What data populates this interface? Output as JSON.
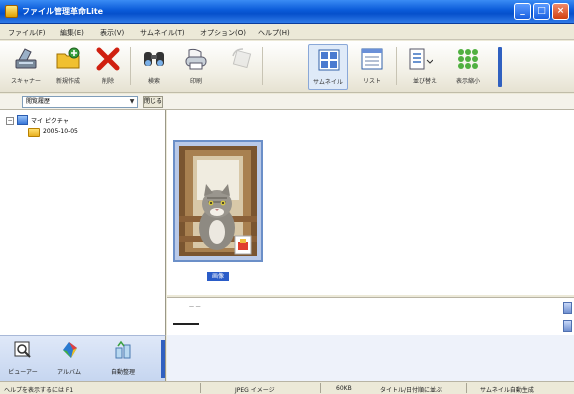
{
  "window": {
    "title": "ファイル管理革命Lite"
  },
  "menu": [
    {
      "label": "ファイル(F)"
    },
    {
      "label": "編集(E)"
    },
    {
      "label": "表示(V)"
    },
    {
      "label": "サムネイル(T)"
    },
    {
      "label": "オプション(O)"
    },
    {
      "label": "ヘルプ(H)"
    }
  ],
  "toolbar": {
    "scanner": "スキャナー",
    "new_folder": "新規作成",
    "delete": "削除",
    "search": "検索",
    "print": "印刷",
    "thumbnail": "サムネイル",
    "list": "リスト",
    "sort": "並び替え",
    "display_size": "表示縮小"
  },
  "folder_bar": {
    "selected": "閲覧履歴",
    "close": "閉じる"
  },
  "tree": {
    "root": "マイ ピクチャ",
    "child": "2005-10-05"
  },
  "thumbnail": {
    "caption": "画像"
  },
  "info": {
    "line1": "— —"
  },
  "tasks": {
    "viewer": "ビューアー",
    "album": "アルバム",
    "auto_organize": "自動整理"
  },
  "status": {
    "help": "ヘルプを表示するには F1",
    "image_type": "JPEG イメージ",
    "size": "60KB",
    "sort_mode": "タイトル/日付順に並ぶ",
    "thumb_mode": "サムネイル自動生成"
  },
  "colors": {
    "titlebar": "#0a5ad8",
    "selection": "#2a5cc8",
    "accent_grip": "#3060c0"
  }
}
